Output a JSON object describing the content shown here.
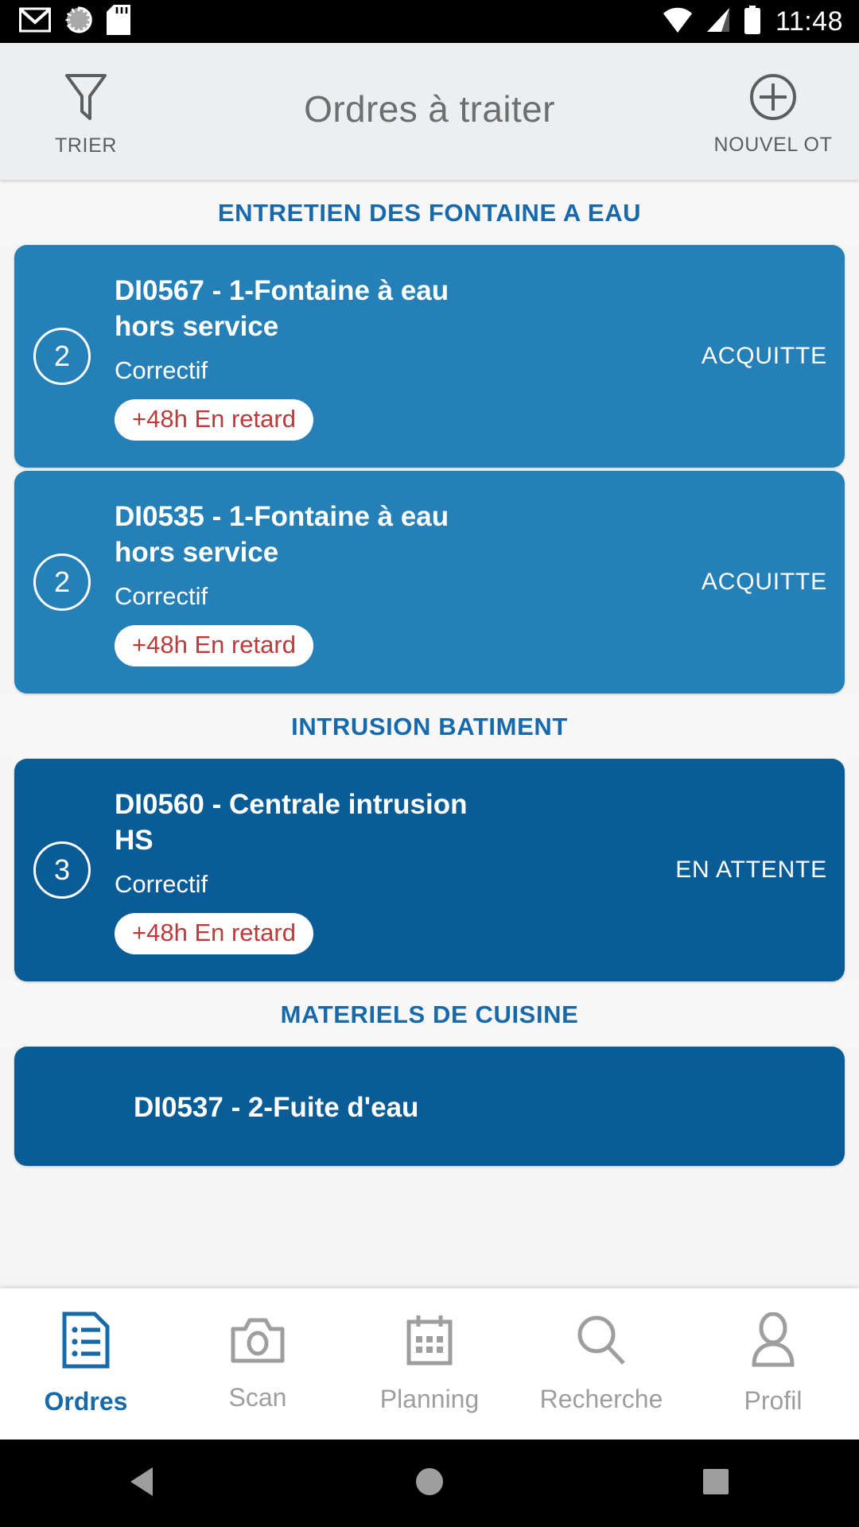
{
  "status_bar": {
    "time": "11:48",
    "left_icons": [
      "gmail-icon",
      "sync-spinner-icon",
      "sd-card-icon"
    ],
    "right_icons": [
      "wifi-icon",
      "signal-icon",
      "battery-icon"
    ]
  },
  "header": {
    "title": "Ordres à traiter",
    "left_action": {
      "label": "TRIER",
      "icon": "filter-funnel-icon"
    },
    "right_action": {
      "label": "NOUVEL OT",
      "icon": "plus-circle-icon"
    }
  },
  "colors": {
    "accent_blue": "#1769aa",
    "card_light": "#2480b6",
    "card_dark": "#0a5c96",
    "late_red": "#bd3a3a",
    "header_bg": "#eceff1"
  },
  "sections": [
    {
      "title": "ENTRETIEN DES FONTAINE A EAU",
      "cards": [
        {
          "count": "2",
          "title": "DI0567 - 1-Fontaine à eau hors service",
          "type": "Correctif",
          "late": "+48h En retard",
          "status": "ACQUITTE",
          "shade": "light"
        },
        {
          "count": "2",
          "title": "DI0535 - 1-Fontaine à eau hors service",
          "type": "Correctif",
          "late": "+48h En retard",
          "status": "ACQUITTE",
          "shade": "light"
        }
      ]
    },
    {
      "title": "INTRUSION BATIMENT",
      "cards": [
        {
          "count": "3",
          "title": "DI0560 - Centrale intrusion HS",
          "type": "Correctif",
          "late": "+48h En retard",
          "status": "EN ATTENTE",
          "shade": "dark"
        }
      ]
    },
    {
      "title": "MATERIELS DE CUISINE",
      "cards": [
        {
          "count": "",
          "title": "DI0537 - 2-Fuite d'eau",
          "type": "",
          "late": "",
          "status": "",
          "shade": "dark"
        }
      ]
    }
  ],
  "bottom_nav": {
    "items": [
      {
        "label": "Ordres",
        "icon": "document-list-icon",
        "active": true
      },
      {
        "label": "Scan",
        "icon": "camera-icon",
        "active": false
      },
      {
        "label": "Planning",
        "icon": "calendar-icon",
        "active": false
      },
      {
        "label": "Recherche",
        "icon": "search-icon",
        "active": false
      },
      {
        "label": "Profil",
        "icon": "person-icon",
        "active": false
      }
    ]
  },
  "android_nav": {
    "back": "back-triangle-icon",
    "home": "home-circle-icon",
    "recents": "recents-square-icon"
  }
}
